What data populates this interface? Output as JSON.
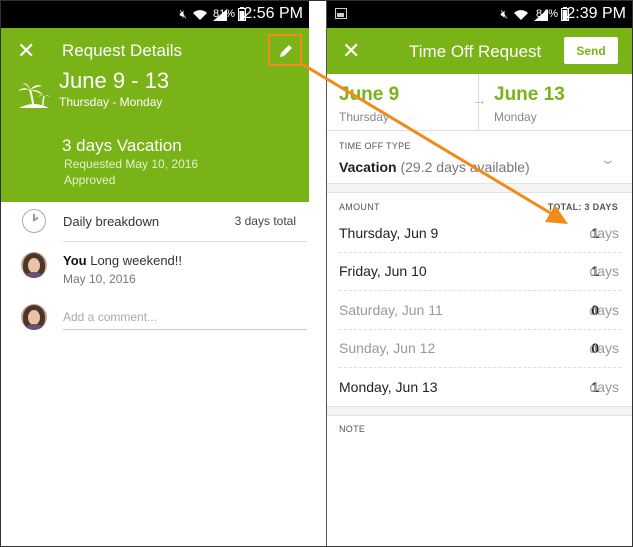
{
  "left": {
    "status": {
      "battery": "81%",
      "time": "2:56 PM"
    },
    "header": {
      "title": "Request Details",
      "dates": "June 9 - 13",
      "days": "Thursday - Monday",
      "vacation": "3 days Vacation",
      "requested": "Requested May 10, 2016",
      "status": "Approved"
    },
    "breakdown": {
      "label": "Daily breakdown",
      "total": "3 days total"
    },
    "comment": {
      "author": "You",
      "text": "Long weekend!!",
      "date": "May 10, 2016"
    },
    "add_comment_placeholder": "Add a comment..."
  },
  "right": {
    "status": {
      "battery": "84%",
      "time": "2:39 PM"
    },
    "header": {
      "title": "Time Off Request",
      "send_label": "Send"
    },
    "start": {
      "date": "June 9",
      "weekday": "Thursday"
    },
    "end": {
      "date": "June 13",
      "weekday": "Monday"
    },
    "type_label": "TIME OFF TYPE",
    "type_value": "Vacation",
    "type_available": "(29.2 days available)",
    "amount_label": "AMOUNT",
    "total_label": "TOTAL: 3 DAYS",
    "rows": [
      {
        "day": "Thursday, Jun 9",
        "amount": "1",
        "unit": "days"
      },
      {
        "day": "Friday, Jun 10",
        "amount": "1",
        "unit": "days"
      },
      {
        "day": "Saturday, Jun 11",
        "amount": "0",
        "unit": "days"
      },
      {
        "day": "Sunday, Jun 12",
        "amount": "0",
        "unit": "days"
      },
      {
        "day": "Monday, Jun 13",
        "amount": "1",
        "unit": "days"
      }
    ],
    "note_label": "NOTE"
  },
  "colors": {
    "green": "#7ab317",
    "annotation_orange": "#f28a1a"
  }
}
